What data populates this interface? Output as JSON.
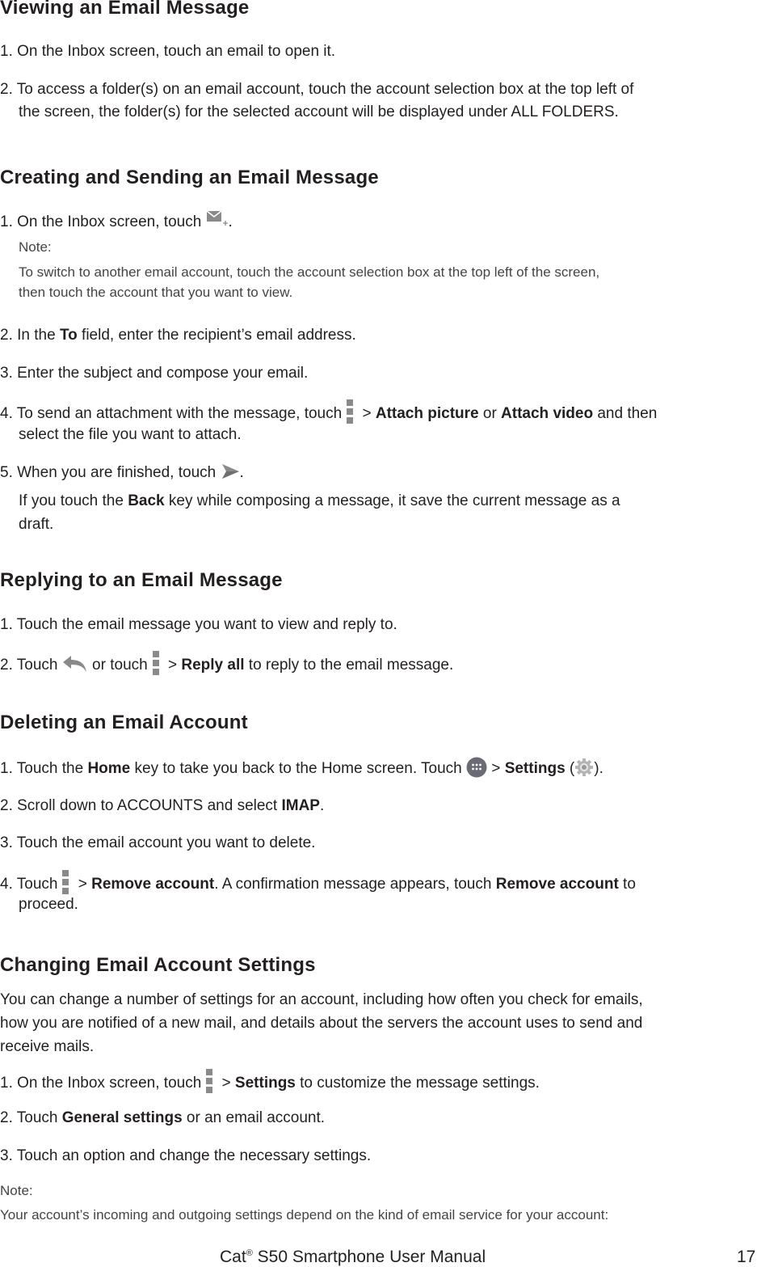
{
  "sections": {
    "viewing": {
      "heading": "Viewing an Email Message",
      "step1": "1. On the Inbox screen, touch an email to open it.",
      "step2_l1": "2. To access a folder(s) on an email account, touch the account selection box at the top left of",
      "step2_l2": "the screen, the folder(s) for the selected account will be displayed under ALL FOLDERS."
    },
    "creating": {
      "heading": "Creating and Sending an Email Message",
      "step1_pre": "1. On the Inbox screen, touch",
      "step1_post": ".",
      "note_label": "Note:",
      "note_l1": "To switch to another email account, touch the account selection box at the top left of the screen,",
      "note_l2": "then touch the account that you want to view.",
      "step2_pre": "2. In the ",
      "step2_bold": "To",
      "step2_post": " field, enter the recipient’s email address.",
      "step3": "3. Enter the subject and compose your email.",
      "step4_pre": "4. To send an attachment with the message, touch",
      "step4_gt": " > ",
      "step4_b1": "Attach picture",
      "step4_or": " or ",
      "step4_b2": "Attach video",
      "step4_post": " and then",
      "step4_l2": "select the file you want to attach.",
      "step5_pre": "5. When you are finished, touch",
      "step5_post": ".",
      "step5_note_pre": "If you touch the ",
      "step5_note_bold": "Back",
      "step5_note_post": " key while composing a message, it save the current message as a",
      "step5_note_l2": "draft."
    },
    "replying": {
      "heading": "Replying to an Email Message",
      "step1": "1. Touch the email message you want to view and reply to.",
      "step2_pre": "2. Touch",
      "step2_mid": " or touch",
      "step2_gt": " > ",
      "step2_bold": "Reply all",
      "step2_post": " to reply to the email message."
    },
    "deleting": {
      "heading": "Deleting an Email Account",
      "step1_pre": "1. Touch the ",
      "step1_b1": "Home",
      "step1_mid": " key to take you back to the Home screen. Touch",
      "step1_gt": " > ",
      "step1_b2": "Settings",
      "step1_open": " (",
      "step1_close": ").",
      "step2_pre": "2. Scroll down to ACCOUNTS and select ",
      "step2_bold": "IMAP",
      "step2_post": ".",
      "step3": "3. Touch the email account you want to delete.",
      "step4_pre": "4. Touch",
      "step4_gt": " > ",
      "step4_b1": "Remove account",
      "step4_mid": ". A confirmation message appears, touch ",
      "step4_b2": "Remove account",
      "step4_post": " to",
      "step4_l2": "proceed."
    },
    "changing": {
      "heading": "Changing Email Account Settings",
      "intro_l1": "You can change a number of settings for an account, including how often you check for emails,",
      "intro_l2": "how you are notified of a new mail, and details about the servers the account uses to send and",
      "intro_l3": "receive mails.",
      "step1_pre": "1. On the Inbox screen, touch",
      "step1_gt": " > ",
      "step1_bold": "Settings",
      "step1_post": " to customize the message settings.",
      "step2_pre": "2. Touch ",
      "step2_bold": "General settings",
      "step2_post": " or an email account.",
      "step3": "3. Touch an option and change the necessary settings.",
      "note_label": "Note:",
      "note_text": "Your account’s incoming and outgoing settings depend on the kind of email service for your account:"
    }
  },
  "icons": {
    "compose": "compose-mail-icon",
    "menu": "overflow-menu-icon",
    "send": "send-icon",
    "reply": "reply-icon",
    "apps": "apps-icon",
    "settings": "settings-gear-icon"
  },
  "footer": {
    "brand": "Cat",
    "reg": "®",
    "title": " S50 Smartphone User Manual",
    "page_number": "17"
  }
}
